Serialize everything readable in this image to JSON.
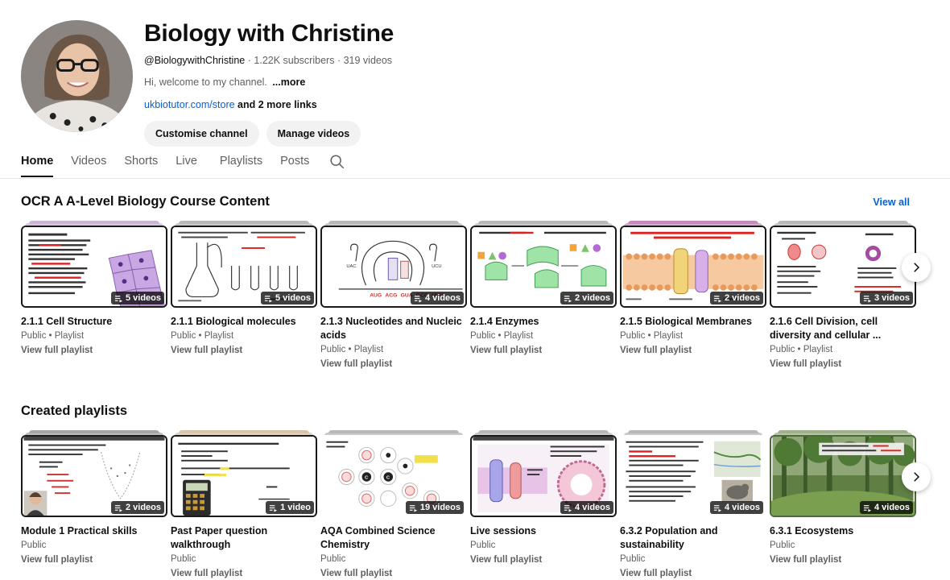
{
  "channel": {
    "name": "Biology with Christine",
    "handle": "@BiologywithChristine",
    "subscribers": "1.22K subscribers",
    "videos": "319 videos",
    "separator": "·",
    "description": "Hi, welcome to my channel.",
    "more_label": "...more",
    "link": "ukbiotutor.com/store",
    "more_links": "and 2 more links",
    "buttons": {
      "customise": "Customise channel",
      "manage": "Manage videos"
    }
  },
  "tabs": [
    {
      "label": "Home",
      "active": true
    },
    {
      "label": "Videos"
    },
    {
      "label": "Shorts"
    },
    {
      "label": "Live"
    },
    {
      "label": "Playlists"
    },
    {
      "label": "Posts"
    }
  ],
  "icons": {
    "search": "search-icon",
    "next": "chevron-right-icon",
    "playlist": "playlist-icon"
  },
  "section1": {
    "title": "OCR A A-Level Biology Course Content",
    "view_all": "View all",
    "cards": [
      {
        "title": "2.1.1 Cell Structure",
        "visibility": "Public",
        "kind": "Playlist",
        "count": "5 videos",
        "link": "View full playlist",
        "stack_color": "#c9b6d6"
      },
      {
        "title": "2.1.1 Biological molecules",
        "visibility": "Public",
        "kind": "Playlist",
        "count": "5 videos",
        "link": "View full playlist",
        "stack_color": "#b8b8b8"
      },
      {
        "title": "2.1.3 Nucleotides and Nucleic acids",
        "visibility": "Public",
        "kind": "Playlist",
        "count": "4 videos",
        "link": "View full playlist",
        "stack_color": "#b8b8b8"
      },
      {
        "title": "2.1.4 Enzymes",
        "visibility": "Public",
        "kind": "Playlist",
        "count": "2 videos",
        "link": "View full playlist",
        "stack_color": "#b8b8b8"
      },
      {
        "title": "2.1.5 Biological Membranes",
        "visibility": "Public",
        "kind": "Playlist",
        "count": "2 videos",
        "link": "View full playlist",
        "stack_color": "#c58bbf"
      },
      {
        "title": "2.1.6 Cell Division, cell diversity and cellular ...",
        "visibility": "Public",
        "kind": "Playlist",
        "count": "3 videos",
        "link": "View full playlist",
        "stack_color": "#b8b8b8"
      }
    ]
  },
  "section2": {
    "title": "Created playlists",
    "cards": [
      {
        "title": "Module 1 Practical skills",
        "visibility": "Public",
        "count": "2 videos",
        "link": "View full playlist",
        "stack_color": "#a7a7a7"
      },
      {
        "title": "Past Paper question walkthrough",
        "visibility": "Public",
        "count": "1 video",
        "link": "View full playlist",
        "stack_color": "#d9c6a9"
      },
      {
        "title": "AQA Combined Science Chemistry",
        "visibility": "Public",
        "count": "19 videos",
        "link": "View full playlist",
        "stack_color": "#b8b8b8"
      },
      {
        "title": "Live sessions",
        "visibility": "Public",
        "count": "4 videos",
        "link": "View full playlist",
        "stack_color": "#b8b8b8"
      },
      {
        "title": "6.3.2 Population and sustainability",
        "visibility": "Public",
        "count": "4 videos",
        "link": "View full playlist",
        "stack_color": "#b8b8b8"
      },
      {
        "title": "6.3.1 Ecosystems",
        "visibility": "Public",
        "count": "4 videos",
        "link": "View full playlist",
        "stack_color": "#9fb08c"
      }
    ]
  }
}
